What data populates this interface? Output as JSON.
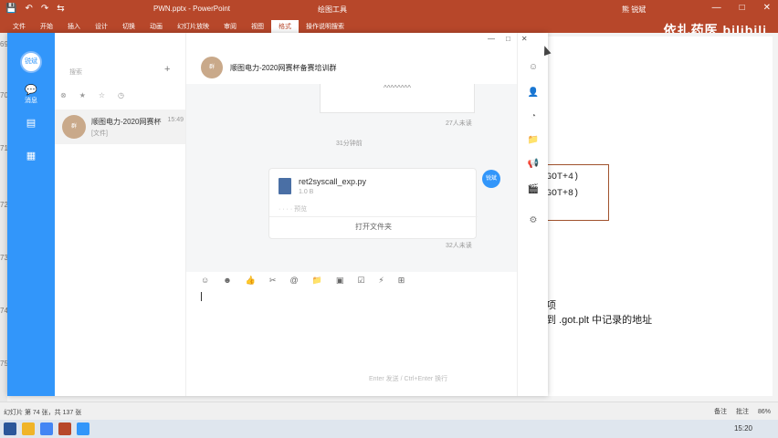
{
  "powerpoint": {
    "quick_access": [
      "💾",
      "↶",
      "↷",
      "⇆"
    ],
    "doc_title": "PWN.pptx - PowerPoint",
    "context_tool": "绘图工具",
    "user": "熊 锐斌",
    "tabs": [
      "文件",
      "开始",
      "插入",
      "设计",
      "切换",
      "动画",
      "幻灯片放映",
      "审阅",
      "视图",
      "格式",
      "操作说明搜索"
    ],
    "selected_tab": "格式",
    "window_controls": [
      "—",
      "□",
      "✕"
    ],
    "ruler_numbers": [
      "69",
      "70",
      "71",
      "72",
      "73",
      "74",
      "75"
    ],
    "slide": {
      "got_lines": [
        "GOT+4)",
        "GOT+8)"
      ],
      "text1": "项",
      "text2": "到 .got.plt 中记录的地址"
    },
    "status": {
      "slide_info": "幻灯片 第 74 张，共 137 张",
      "notes": "备注",
      "comments": "批注",
      "zoom": "86%"
    }
  },
  "overlay": {
    "brand": "依扎药医 bilibili"
  },
  "dingtalk": {
    "window_controls": [
      "—",
      "□",
      "✕"
    ],
    "sidebar": {
      "avatar_text": "锐斌",
      "items": [
        {
          "icon": "chat-icon",
          "glyph": "💬",
          "label": "消息"
        },
        {
          "icon": "doc-icon",
          "glyph": "▤",
          "label": ""
        },
        {
          "icon": "app-icon",
          "glyph": "▦",
          "label": ""
        }
      ]
    },
    "search": {
      "placeholder": "搜索"
    },
    "add_button": "+",
    "filter_icons": [
      "⊗",
      "★",
      "☆",
      "◷"
    ],
    "conversation": {
      "avatar_text": "群",
      "name": "顺图电力-2020网赛杯",
      "time": "15:49",
      "preview": "[文件]"
    },
    "chat": {
      "title": "顺图电力-2020网赛杯备赛培训群",
      "avatar_text": "群",
      "prev_card_text": "^^^^^^^^",
      "read1": "27人未读",
      "timestamp": "31分钟前",
      "file": {
        "name": "ret2syscall_exp.py",
        "size": "1.0 B",
        "meta": "· · · · 预览",
        "open_label": "打开文件夹"
      },
      "sender_avatar": "锐斌",
      "read2": "32人未读",
      "toolbar": [
        "☺",
        "☻",
        "👍",
        "✂",
        "@",
        "📁",
        "▣",
        "☑",
        "⚡",
        "⊞"
      ],
      "send_hint": "Enter 发送 / Ctrl+Enter 换行"
    },
    "right_icons": [
      "☺",
      "👤",
      "◔",
      "📁",
      "📢",
      "🎬",
      "⚙"
    ]
  },
  "taskbar": {
    "clock": "15:20"
  }
}
